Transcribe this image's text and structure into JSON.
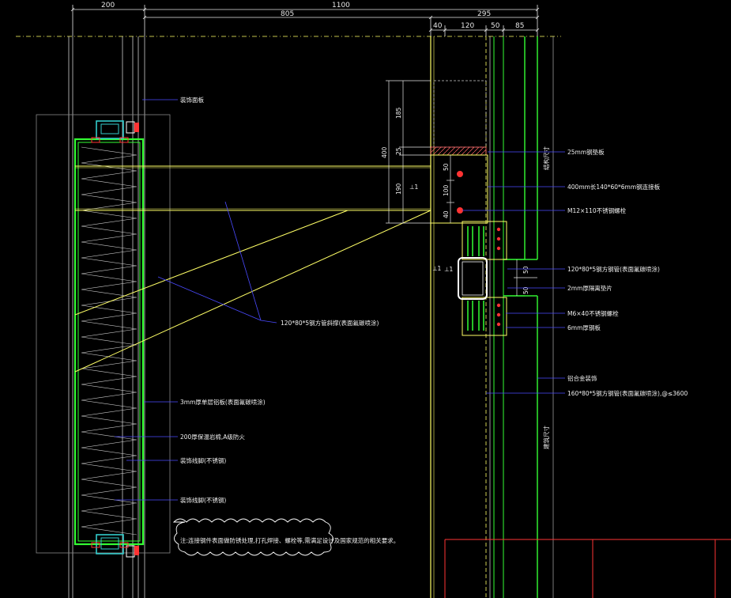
{
  "colors": {
    "background": "#000000",
    "dimension": "#e6e6e6",
    "yellow": "#ffff66",
    "green": "#33ff33",
    "cyan": "#33cccc",
    "blue_leader": "#4a4aff",
    "red": "#ff3333",
    "white": "#ffffff"
  },
  "dimensions_top": {
    "d200": "200",
    "d1100": "1100",
    "d805": "805",
    "d295": "295",
    "d40": "40",
    "d120": "120",
    "d50": "50",
    "d85": "85"
  },
  "dimensions_side": {
    "d400": "400",
    "d185": "185",
    "d25": "25",
    "d190": "190",
    "d50a": "50",
    "d100": "100",
    "d40a": "40",
    "d50b": "50",
    "d50c": "50"
  },
  "markers": {
    "angle1": "⊥1",
    "angle2": "⊥1",
    "angle3": "⊥1"
  },
  "vertical_labels": {
    "upper": "结构尺寸",
    "lower": "建筑尺寸"
  },
  "annotations": {
    "a1": "装饰面板",
    "a2": "25mm钢垫板",
    "a3": "400mm长140*60*6mm钢连接板",
    "a4": "M12×110不锈钢螺栓",
    "a5": "120*80*5钢方管斜撑(表面氟碳喷涂)",
    "a6": "120*80*5钢方钢管(表面氟碳喷涂)",
    "a7": "2mm厚隔离垫片",
    "a8": "M6×40不锈钢螺栓",
    "a9": "6mm厚钢板",
    "a10": "铝合金装饰",
    "a11": "160*80*5钢方钢管(表面氟碳喷涂),@≤3600",
    "a12": "3mm厚单层铝板(表面氟碳喷涂)",
    "a13": "200厚保温岩棉,A级防火",
    "a14": "装饰线脚(不锈钢)",
    "a15": "装饰线脚(不锈钢)"
  },
  "cloud_note": "注:连接钢件表面做防锈处理,打孔焊接、螺栓等,需满足设计及国家规范的相关要求。"
}
